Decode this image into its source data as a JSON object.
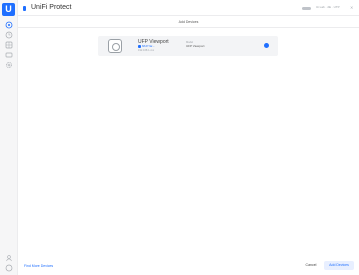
{
  "app": {
    "logo_letter": "U",
    "brand": "UniFi Protect"
  },
  "header": {
    "user_text": "Ui Lab · 2E · UTP",
    "close_symbol": "✕"
  },
  "page": {
    "title": "Add Devices"
  },
  "device": {
    "name": "UFP Viewport",
    "mac": "68:d7:9a:...",
    "ip": "192.168.1.xxx",
    "model_label": "Model",
    "model": "UFP Viewport",
    "selected": true
  },
  "footer": {
    "find_link": "Find More Devices",
    "cancel": "Cancel",
    "add": "Add Devices"
  },
  "colors": {
    "accent": "#1f6fff"
  },
  "rail_icons": [
    "camera-icon",
    "clock-icon",
    "grid-icon",
    "layout-icon",
    "gear-icon",
    "user-icon",
    "help-icon"
  ]
}
